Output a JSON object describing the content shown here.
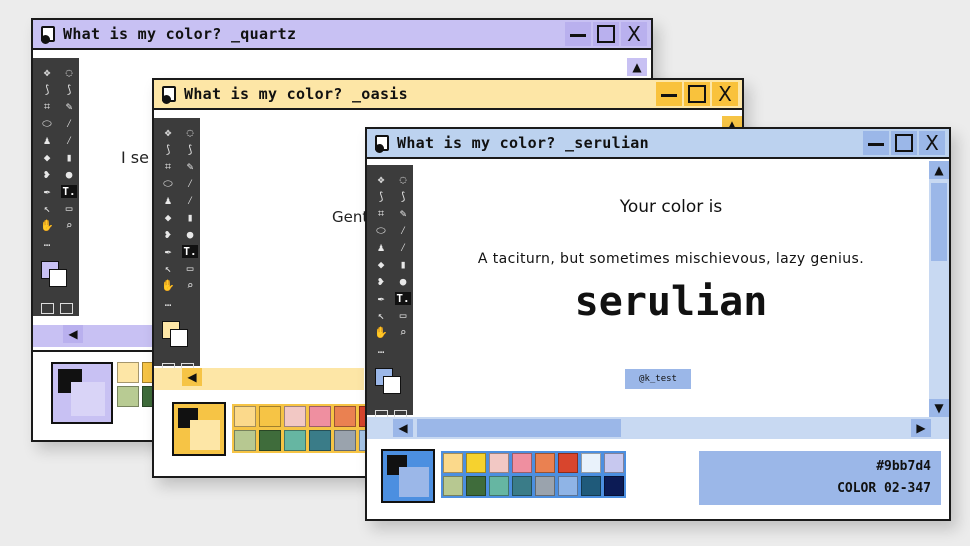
{
  "windows": {
    "quartz": {
      "title": "What is my color? _quartz",
      "content_partial": "I se",
      "accent": "#c8c1f3",
      "palette": [
        "#fde6a6",
        "#f6c445",
        "#9fb8d6",
        "#c9d8ef",
        "#b8cb93",
        "#3f6c3b",
        "#8fa9c8",
        "#dfe8f5"
      ]
    },
    "oasis": {
      "title": "What is my color? _oasis",
      "content_partial": "Gent",
      "accent": "#fde6a6",
      "palette": [
        "#fbd98b",
        "#f6c445",
        "#f2c8c4",
        "#ef8fa0",
        "#ea8151",
        "#d8452d",
        "#b7c891",
        "#3f6c3b",
        "#66b6a2",
        "#3a7c88",
        "#9aa3ad",
        "#a7c6e8"
      ]
    },
    "serulian": {
      "title": "What is my color? _serulian",
      "heading": "Your color is",
      "description": "A taciturn, but sometimes mischievous, lazy genius.",
      "color_name": "serulian",
      "credit": "@k_test",
      "hex_code": "#9bb7d4",
      "color_code": "COLOR 02-347",
      "accent": "#9bb7e8",
      "palette": [
        "#fbd98b",
        "#f6d22e",
        "#f2c8c4",
        "#ef8fa0",
        "#ea8151",
        "#d8452d",
        "#e9f2fb",
        "#c7c8ef",
        "#b7c891",
        "#3f6c3b",
        "#66b6a2",
        "#3a7c88",
        "#9aa3ad",
        "#8fb4e6",
        "#1f5a7a",
        "#0c1b55"
      ]
    }
  },
  "icons": {
    "file": "file-icon",
    "minimize": "minimize-icon",
    "maximize": "maximize-icon",
    "close": "close-icon",
    "scroll_up": "triangle-up-icon",
    "scroll_down": "triangle-down-icon",
    "scroll_left": "triangle-left-icon",
    "scroll_right": "triangle-right-icon"
  },
  "tool_glyphs": [
    "✥",
    "◌",
    "⟆",
    "⟆",
    "⌗",
    "✎",
    "⬭",
    "⁄",
    "♟",
    "⁄",
    "◆",
    "▮",
    "❥",
    "●",
    "✒",
    "T",
    "↖",
    "▭",
    "✋",
    "⌕",
    "…",
    ""
  ],
  "controls": {
    "close_label": "X",
    "text_tool_label": "T."
  }
}
